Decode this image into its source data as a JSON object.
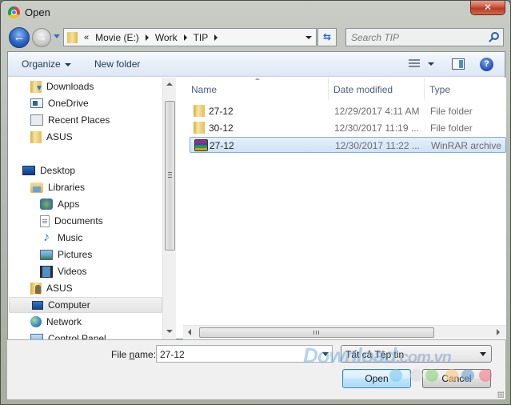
{
  "window": {
    "title": "Open",
    "close_label": "✕"
  },
  "navigation": {
    "back_label": "←",
    "forward_label": "→",
    "overflow_chevron": "«",
    "breadcrumbs": [
      "Movie (E:)",
      "Work",
      "TIP"
    ],
    "refresh_label": "⇆",
    "search_placeholder": "Search TIP"
  },
  "toolbar": {
    "organize_label": "Organize",
    "new_folder_label": "New folder",
    "help_label": "?"
  },
  "nav_pane": {
    "items": [
      {
        "label": "Downloads",
        "icon": "downloads-icon"
      },
      {
        "label": "OneDrive",
        "icon": "onedrive-icon"
      },
      {
        "label": "Recent Places",
        "icon": "recent-places-icon"
      },
      {
        "label": "ASUS",
        "icon": "folder-icon"
      },
      {
        "label": "Desktop",
        "icon": "desktop-icon"
      },
      {
        "label": "Libraries",
        "icon": "libraries-icon"
      },
      {
        "label": "Apps",
        "icon": "apps-icon"
      },
      {
        "label": "Documents",
        "icon": "documents-icon"
      },
      {
        "label": "Music",
        "icon": "music-icon"
      },
      {
        "label": "Pictures",
        "icon": "pictures-icon"
      },
      {
        "label": "Videos",
        "icon": "videos-icon"
      },
      {
        "label": "ASUS",
        "icon": "user-folder-icon"
      },
      {
        "label": "Computer",
        "icon": "computer-icon",
        "selected": true
      },
      {
        "label": "Network",
        "icon": "network-icon"
      },
      {
        "label": "Control Panel",
        "icon": "control-panel-icon"
      }
    ]
  },
  "file_list": {
    "columns": [
      "Name",
      "Date modified",
      "Type"
    ],
    "rows": [
      {
        "name": "27-12",
        "date": "12/29/2017 4:11 AM",
        "type": "File folder",
        "icon": "folder-icon"
      },
      {
        "name": "30-12",
        "date": "12/30/2017 11:19 ...",
        "type": "File folder",
        "icon": "folder-icon"
      },
      {
        "name": "27-12",
        "date": "12/30/2017 11:22 ...",
        "type": "WinRAR archive",
        "icon": "winrar-icon",
        "selected": true
      }
    ]
  },
  "footer": {
    "file_name_label_pre": "File ",
    "file_name_label_u": "n",
    "file_name_label_post": "ame:",
    "file_name_value": "27-12",
    "file_type_filter": "Tất cả Tệp tin",
    "open_label": "Open",
    "cancel_label": "Cancel"
  },
  "watermark": {
    "main": "Download",
    "tail": ".com.vn"
  },
  "colors": {
    "selection_fill": "#cfe2f5",
    "selection_border": "#84acdd",
    "close_button": "#c8432b",
    "link_text": "#1e395b"
  }
}
